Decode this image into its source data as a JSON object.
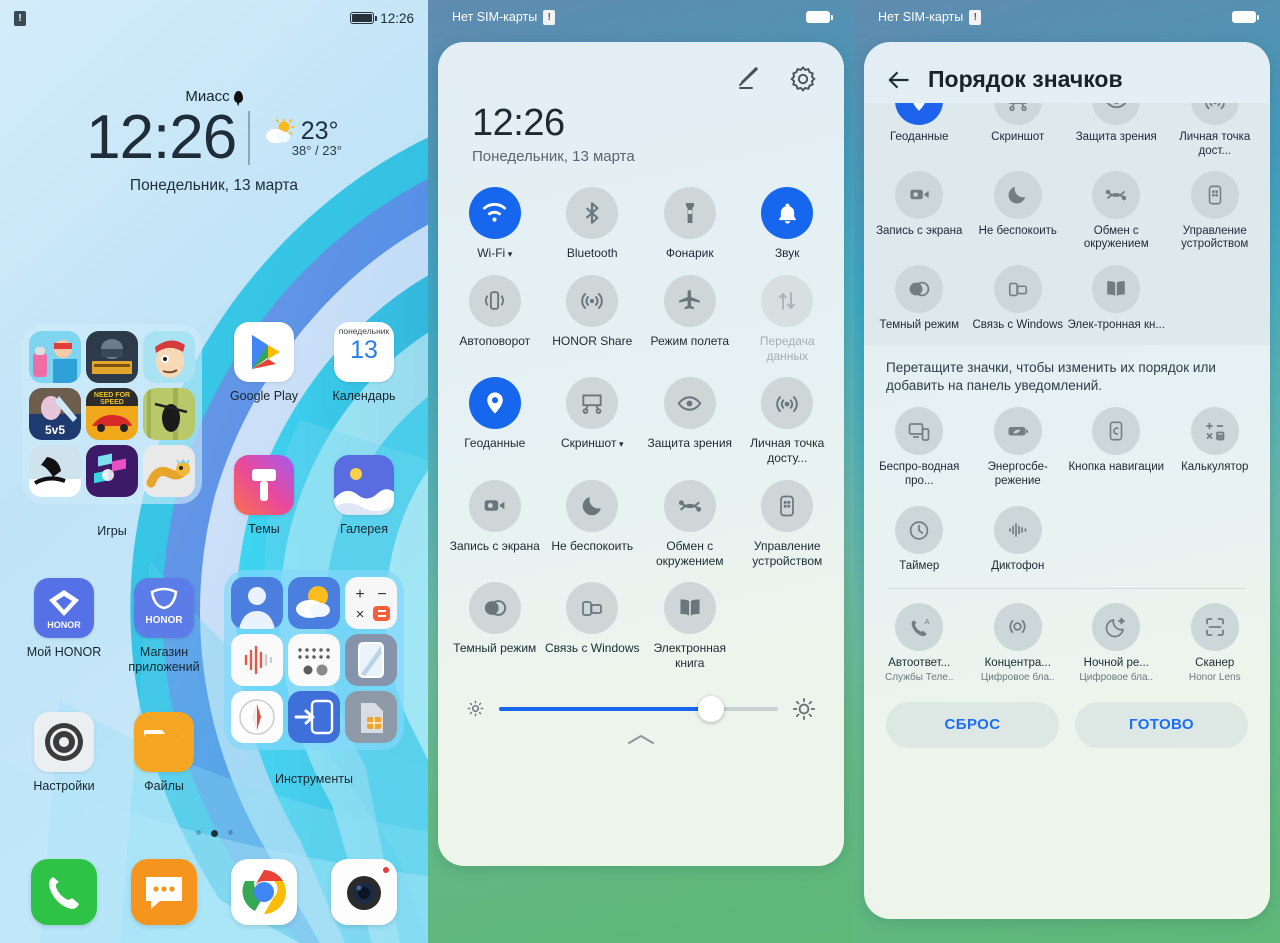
{
  "home": {
    "status": {
      "time": "12:26",
      "sim_icon": "sim-alert-icon",
      "battery_icon": "battery-icon"
    },
    "lock": {
      "city": "Миасс",
      "time": "12:26",
      "date": "Понедельник, 13 марта",
      "weather_temp": "23°",
      "weather_range": "38° / 23°"
    },
    "folders": [
      {
        "name": "Игры",
        "label": "Игры"
      },
      {
        "name": "Инструменты",
        "label": "Инструменты"
      }
    ],
    "apps": [
      {
        "label": "Google Play",
        "icon": "google-play-icon"
      },
      {
        "label": "Календарь",
        "icon": "calendar-icon",
        "cal_weekday": "понедельник",
        "cal_day": "13"
      },
      {
        "label": "Темы",
        "icon": "themes-icon"
      },
      {
        "label": "Галерея",
        "icon": "gallery-icon"
      },
      {
        "label": "Мой HONOR",
        "icon": "my-honor-icon"
      },
      {
        "label": "Магазин приложений",
        "icon": "appstore-icon"
      },
      {
        "label": "Настройки",
        "icon": "settings-gear-icon"
      },
      {
        "label": "Файлы",
        "icon": "files-folder-icon"
      }
    ],
    "dock": [
      {
        "label": "Телефон",
        "icon": "phone-icon"
      },
      {
        "label": "Сообщения",
        "icon": "messages-icon"
      },
      {
        "label": "Chrome",
        "icon": "chrome-icon"
      },
      {
        "label": "Камера",
        "icon": "camera-icon"
      }
    ],
    "pages": {
      "count": 3,
      "active": 1
    }
  },
  "quick_settings": {
    "status": {
      "sim_text": "Нет SIM-карты",
      "sim_icon": "sim-alert-icon",
      "battery_icon": "battery-icon"
    },
    "header": {
      "edit_icon": "pencil-edit-icon",
      "settings_icon": "gear-icon"
    },
    "time": "12:26",
    "date": "Понедельник, 13 марта",
    "tiles": [
      {
        "label": "Wi-Fi",
        "icon": "wifi-icon",
        "state": "on",
        "has_caret": true
      },
      {
        "label": "Bluetooth",
        "icon": "bluetooth-icon",
        "state": "off"
      },
      {
        "label": "Фонарик",
        "icon": "flashlight-icon",
        "state": "off"
      },
      {
        "label": "Звук",
        "icon": "bell-sound-icon",
        "state": "on"
      },
      {
        "label": "Автоповорот",
        "icon": "auto-rotate-icon",
        "state": "off"
      },
      {
        "label": "HONOR Share",
        "icon": "honor-share-icon",
        "state": "off"
      },
      {
        "label": "Режим полета",
        "icon": "airplane-icon",
        "state": "off"
      },
      {
        "label": "Передача данных",
        "icon": "data-transfer-icon",
        "state": "disabled"
      },
      {
        "label": "Геоданные",
        "icon": "location-pin-icon",
        "state": "on"
      },
      {
        "label": "Скриншот",
        "icon": "screenshot-icon",
        "state": "off",
        "has_caret": true
      },
      {
        "label": "Защита зрения",
        "icon": "eye-care-icon",
        "state": "off"
      },
      {
        "label": "Личная точка досту...",
        "icon": "hotspot-icon",
        "state": "off"
      },
      {
        "label": "Запись с экрана",
        "icon": "screen-record-icon",
        "state": "off"
      },
      {
        "label": "Не беспокоить",
        "icon": "moon-dnd-icon",
        "state": "off"
      },
      {
        "label": "Обмен с окружением",
        "icon": "nearby-share-icon",
        "state": "off"
      },
      {
        "label": "Управление устройством",
        "icon": "device-control-icon",
        "state": "off"
      },
      {
        "label": "Темный режим",
        "icon": "dark-mode-icon",
        "state": "off"
      },
      {
        "label": "Связь с Windows",
        "icon": "link-windows-icon",
        "state": "off"
      },
      {
        "label": "Электронная книга",
        "icon": "ebook-icon",
        "state": "off"
      }
    ],
    "brightness": {
      "value_percent": 76,
      "low_icon": "brightness-low-icon",
      "high_icon": "brightness-high-icon"
    },
    "expand_icon": "chevron-up-icon"
  },
  "icon_order": {
    "status": {
      "sim_text": "Нет SIM-карты",
      "sim_icon": "sim-alert-icon",
      "battery_icon": "battery-icon"
    },
    "title": "Порядок значков",
    "back_icon": "back-arrow-icon",
    "active_tiles_row_cut": [
      {
        "label": "Геоданные",
        "icon": "location-pin-icon",
        "state": "on"
      },
      {
        "label": "Скриншот",
        "icon": "screenshot-icon",
        "state": "off"
      },
      {
        "label": "Защита зрения",
        "icon": "eye-care-icon",
        "state": "off"
      },
      {
        "label": "Личная точка дост...",
        "icon": "hotspot-icon",
        "state": "off"
      }
    ],
    "active_tiles": [
      {
        "label": "Запись с экрана",
        "icon": "screen-record-icon"
      },
      {
        "label": "Не беспокоить",
        "icon": "moon-dnd-icon"
      },
      {
        "label": "Обмен с окружением",
        "icon": "nearby-share-icon"
      },
      {
        "label": "Управление устройством",
        "icon": "device-control-icon"
      },
      {
        "label": "Темный режим",
        "icon": "dark-mode-icon"
      },
      {
        "label": "Связь с Windows",
        "icon": "link-windows-icon"
      },
      {
        "label": "Элек-тронная кн...",
        "icon": "ebook-icon"
      }
    ],
    "hint": "Перетащите значки, чтобы изменить их порядок или добавить на панель уведомлений.",
    "available_tiles": [
      {
        "label": "Беспро-водная про...",
        "icon": "wireless-projection-icon"
      },
      {
        "label": "Энергосбе-режение",
        "icon": "power-save-icon"
      },
      {
        "label": "Кнопка навигации",
        "icon": "nav-button-icon"
      },
      {
        "label": "Калькулятор",
        "icon": "calculator-icon"
      },
      {
        "label": "Таймер",
        "icon": "timer-icon"
      },
      {
        "label": "Диктофон",
        "icon": "voice-recorder-icon"
      }
    ],
    "third_party_tiles": [
      {
        "label": "Автоответ...",
        "sub": "Службы Теле..",
        "icon": "auto-answer-icon"
      },
      {
        "label": "Концентра...",
        "sub": "Цифровое бла..",
        "icon": "focus-mode-icon"
      },
      {
        "label": "Ночной ре...",
        "sub": "Цифровое бла..",
        "icon": "night-mode-icon"
      },
      {
        "label": "Сканер",
        "sub": "Honor Lens",
        "icon": "scanner-icon"
      }
    ],
    "buttons": {
      "reset": "СБРОС",
      "done": "ГОТОВО"
    },
    "accent_color": "#1a6ff5"
  }
}
